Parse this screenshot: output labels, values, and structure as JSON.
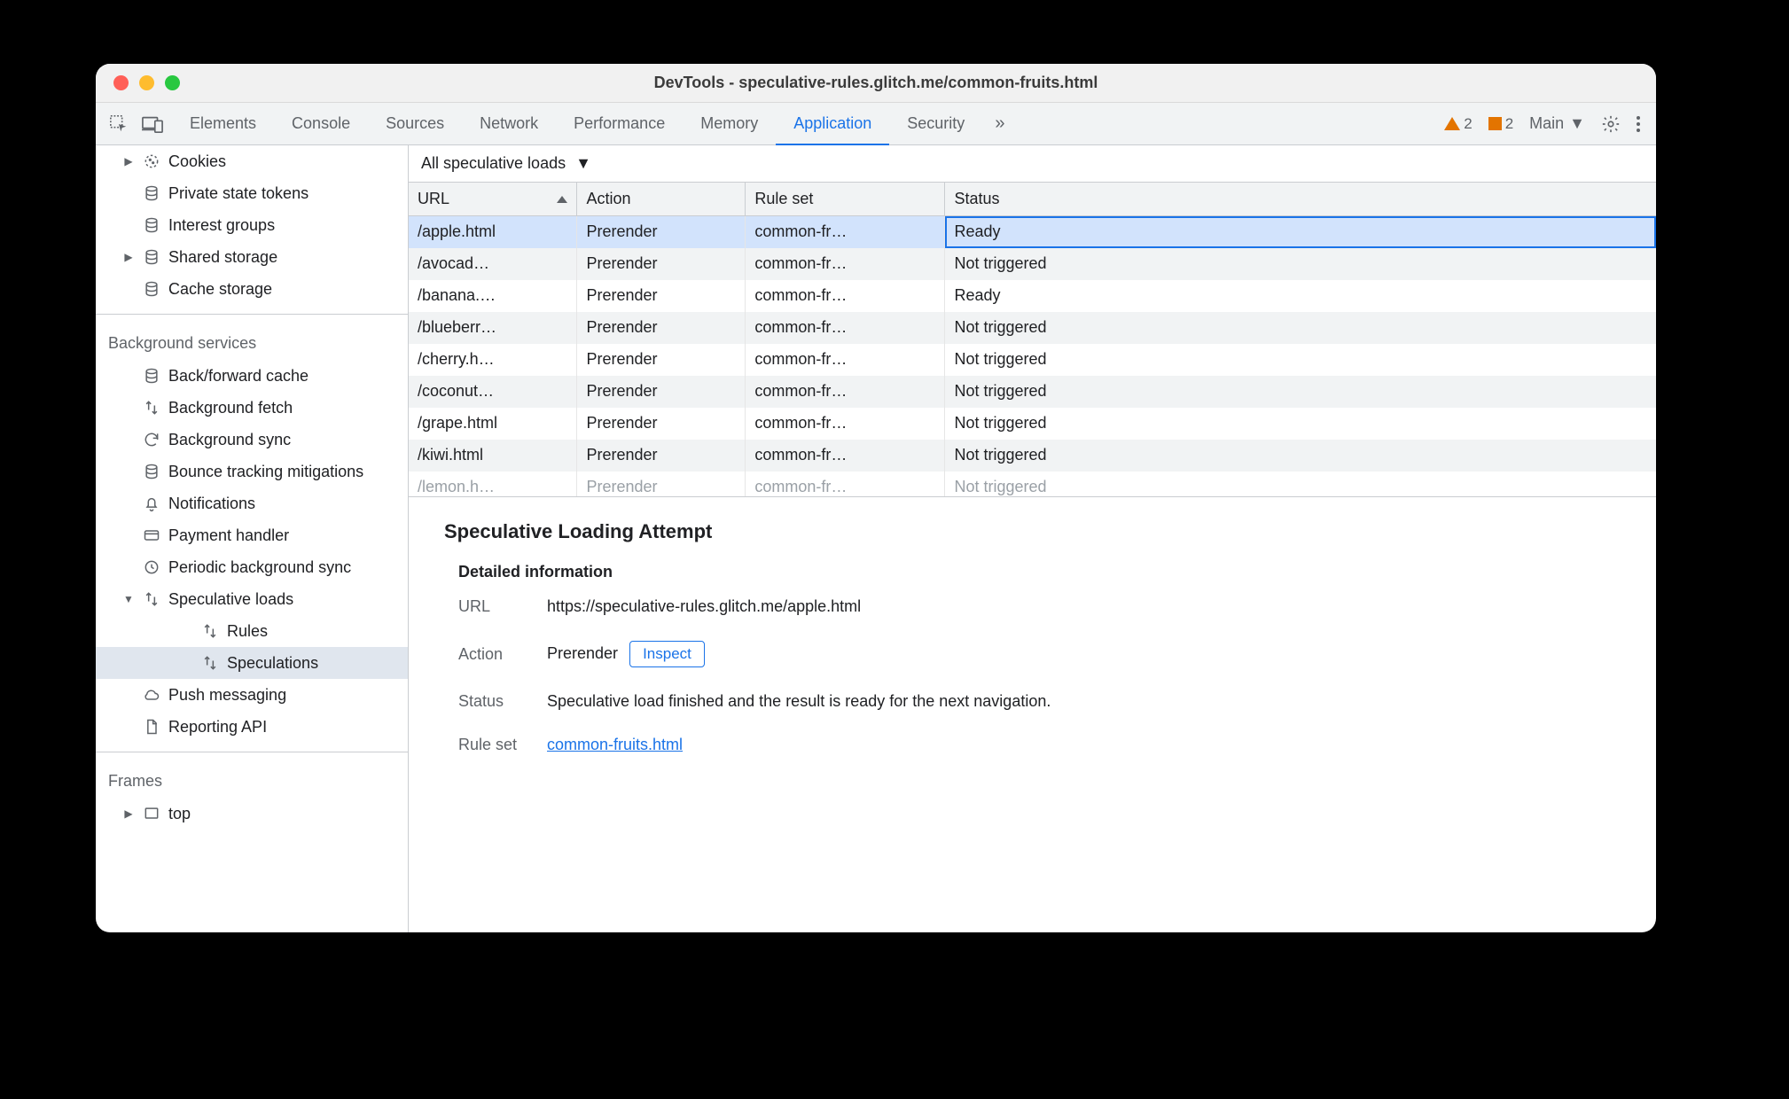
{
  "window": {
    "title": "DevTools - speculative-rules.glitch.me/common-fruits.html"
  },
  "toolbar": {
    "tabs": [
      {
        "label": "Elements",
        "active": false
      },
      {
        "label": "Console",
        "active": false
      },
      {
        "label": "Sources",
        "active": false
      },
      {
        "label": "Network",
        "active": false
      },
      {
        "label": "Performance",
        "active": false
      },
      {
        "label": "Memory",
        "active": false
      },
      {
        "label": "Application",
        "active": true
      },
      {
        "label": "Security",
        "active": false
      }
    ],
    "overflow_label": "»",
    "warnings_count": "2",
    "issues_count": "2",
    "target_label": "Main"
  },
  "sidebar": {
    "top_items": [
      {
        "label": "Cookies",
        "icon": "cookie",
        "arrow": "right",
        "depth": 1
      },
      {
        "label": "Private state tokens",
        "icon": "db",
        "depth": 1
      },
      {
        "label": "Interest groups",
        "icon": "db",
        "depth": 1
      },
      {
        "label": "Shared storage",
        "icon": "db",
        "arrow": "right",
        "depth": 1
      },
      {
        "label": "Cache storage",
        "icon": "db",
        "depth": 1
      }
    ],
    "heading_bg": "Background services",
    "bg_items": [
      {
        "label": "Back/forward cache",
        "icon": "db",
        "depth": 1
      },
      {
        "label": "Background fetch",
        "icon": "updown",
        "depth": 1
      },
      {
        "label": "Background sync",
        "icon": "sync",
        "depth": 1
      },
      {
        "label": "Bounce tracking mitigations",
        "icon": "db",
        "depth": 1
      },
      {
        "label": "Notifications",
        "icon": "bell",
        "depth": 1
      },
      {
        "label": "Payment handler",
        "icon": "card",
        "depth": 1
      },
      {
        "label": "Periodic background sync",
        "icon": "clock",
        "depth": 1
      },
      {
        "label": "Speculative loads",
        "icon": "updown",
        "arrow": "down",
        "depth": 1
      },
      {
        "label": "Rules",
        "icon": "updown",
        "depth": 3
      },
      {
        "label": "Speculations",
        "icon": "updown",
        "depth": 3,
        "selected": true
      },
      {
        "label": "Push messaging",
        "icon": "cloud",
        "depth": 1
      },
      {
        "label": "Reporting API",
        "icon": "file",
        "depth": 1
      }
    ],
    "heading_frames": "Frames",
    "frames_items": [
      {
        "label": "top",
        "icon": "frame",
        "arrow": "right",
        "depth": 1
      }
    ]
  },
  "filter": {
    "label": "All speculative loads"
  },
  "table": {
    "columns": [
      {
        "label": "URL",
        "sort": "asc",
        "w": "13.5%"
      },
      {
        "label": "Action",
        "w": "13.5%"
      },
      {
        "label": "Rule set",
        "w": "16%"
      },
      {
        "label": "Status",
        "w": "57%"
      }
    ],
    "rows": [
      {
        "url": "/apple.html",
        "action": "Prerender",
        "ruleset": "common-fr…",
        "status": "Ready",
        "selected": true
      },
      {
        "url": "/avocad…",
        "action": "Prerender",
        "ruleset": "common-fr…",
        "status": "Not triggered"
      },
      {
        "url": "/banana.…",
        "action": "Prerender",
        "ruleset": "common-fr…",
        "status": "Ready"
      },
      {
        "url": "/blueberr…",
        "action": "Prerender",
        "ruleset": "common-fr…",
        "status": "Not triggered"
      },
      {
        "url": "/cherry.h…",
        "action": "Prerender",
        "ruleset": "common-fr…",
        "status": "Not triggered"
      },
      {
        "url": "/coconut…",
        "action": "Prerender",
        "ruleset": "common-fr…",
        "status": "Not triggered"
      },
      {
        "url": "/grape.html",
        "action": "Prerender",
        "ruleset": "common-fr…",
        "status": "Not triggered"
      },
      {
        "url": "/kiwi.html",
        "action": "Prerender",
        "ruleset": "common-fr…",
        "status": "Not triggered"
      },
      {
        "url": "/lemon.h…",
        "action": "Prerender",
        "ruleset": "common-fr…",
        "status": "Not triggered",
        "peek": true
      }
    ]
  },
  "detail": {
    "heading": "Speculative Loading Attempt",
    "section_title": "Detailed information",
    "url_label": "URL",
    "url_value": "https://speculative-rules.glitch.me/apple.html",
    "action_label": "Action",
    "action_value": "Prerender",
    "inspect_label": "Inspect",
    "status_label": "Status",
    "status_value": "Speculative load finished and the result is ready for the next navigation.",
    "ruleset_label": "Rule set",
    "ruleset_value": "common-fruits.html"
  }
}
